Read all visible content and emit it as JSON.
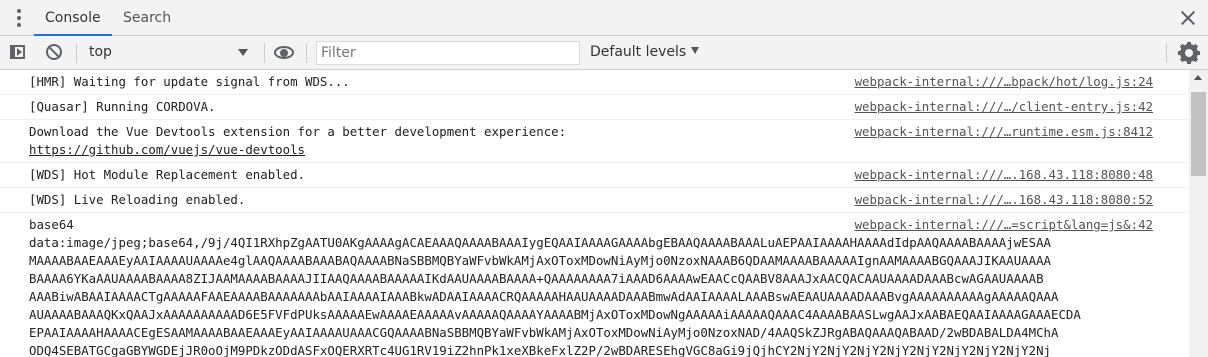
{
  "tabs": [
    {
      "label": "Console",
      "active": true
    },
    {
      "label": "Search",
      "active": false
    }
  ],
  "toolbar": {
    "context": "top",
    "filter_placeholder": "Filter",
    "filter_value": "",
    "levels": "Default levels"
  },
  "messages": [
    {
      "text": "[HMR] Waiting for update signal from WDS...",
      "source": "webpack-internal:///…bpack/hot/log.js:24"
    },
    {
      "text": "[Quasar] Running CORDOVA.",
      "source": "webpack-internal:///…/client-entry.js:42"
    },
    {
      "text": "Download the Vue Devtools extension for a better development experience:",
      "link": "https://github.com/vuejs/vue-devtools",
      "source": "webpack-internal:///…runtime.esm.js:8412"
    },
    {
      "text": "[WDS] Hot Module Replacement enabled.",
      "source": "webpack-internal:///….168.43.118:8080:48"
    },
    {
      "text": "[WDS] Live Reloading enabled.",
      "source": "webpack-internal:///….168.43.118:8080:52"
    },
    {
      "text": "base64",
      "source": "webpack-internal:///…=script&lang=js&:42",
      "lines": [
        "data:image/jpeg;base64,/9j/4QI1RXhpZgAATU0AKgAAAAgACAEAAAQAAAABAAAIygEQAAIAAAAGAAAAbgEBAAQAAAABAAALuAEPAAIAAAAHAAAAdIdpAAQAAAABAAAAjwESAA",
        "MAAAABAAEAAAEyAAIAAAAUAAAAe4glAAQAAAABAAABAQAAAABNaSBBMQBYaWFvbWkAMjAxOToxMDowNiAyMjo0NzoxNAAAB6QDAAMAAAABAAAAAIgnAAMAAAABGQAAAJIKAAUAAAA",
        "BAAAA6YKaAAUAAAABAAAA8ZIJAAMAAAABAAAAJIIAAQAAAABAAAAAIKdAAUAAAABAAAA+QAAAAAAAA7iAAAD6AAAAwEAACcQAABV8AAAJxAACQACAAUAAAADAAABcwAGAAUAAAAB",
        "AAABiwABAAIAAAACTgAAAAAFAAEAAAABAAAAAAAbAAIAAAAIAAABkwADAAIAAAACRQAAAAAHAAUAAAADAAABmwAdAAIAAAALAAABswAEAAUAAAADAAABvgAAAAAAAAAAgAAAAAQAAA",
        "AUAAAABAAAQKxQAAJxAAAAAAAAAAD6E5FVFdPUksAAAAAEwAAAAEAAAAAvAAAAAQAAAAYAAAABMjAxOToxMDowNgAAAAAiAAAAAQAAAC4AAAABAASLwgAAJxAABAEQAAIAAAAGAAAECDA",
        "EPAAIAAAAHAAAACEgESAAMAAAABAAEAAAEyAAIAAAAUAAACGQAAAABNaSBBMQBYaWFvbWkAMjAxOToxMDowNiAyMjo0NzoxNAD/4AAQSkZJRgABAQAAAQABAAD/2wBDABALDA4MChA",
        "ODQ4SEBATGCgaGBYWGDEjJR0oOjM9PDkzODdASFxOQERXRTc4UG1RV19iZ2hnPk1xeXBkeFxlZ2P/2wBDARESEhgVGC8aGi9jQjhCY2NjY2NjY2NjY2NjY2NjY2NjY2NjY2NjY2Nj"
      ]
    }
  ]
}
